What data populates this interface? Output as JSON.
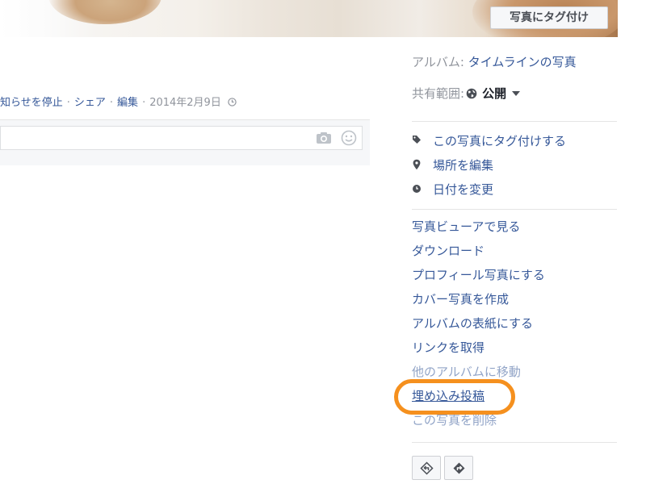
{
  "photo": {
    "tag_button_label": "写真にタグ付け"
  },
  "story": {
    "meta": {
      "unfollow": "知らせを停止",
      "share": "シェア",
      "edit": "編集",
      "date": "2014年2月9日",
      "separator": "·"
    },
    "comment": {
      "placeholder": ""
    }
  },
  "sidebar": {
    "album": {
      "key": "アルバム:",
      "value": "タイムラインの写真"
    },
    "privacy": {
      "key": "共有範囲:",
      "value": "公開"
    },
    "actions": [
      {
        "label": "この写真にタグ付けする",
        "icon": "tag-icon"
      },
      {
        "label": "場所を編集",
        "icon": "location-pin-icon"
      },
      {
        "label": "日付を変更",
        "icon": "clock-icon"
      }
    ],
    "links": [
      {
        "label": "写真ビューアで見る"
      },
      {
        "label": "ダウンロード"
      },
      {
        "label": "プロフィール写真にする"
      },
      {
        "label": "カバー写真を作成"
      },
      {
        "label": "アルバムの表紙にする"
      },
      {
        "label": "リンクを取得"
      },
      {
        "label": "他のアルバムに移動"
      },
      {
        "label": "埋め込み投稿"
      },
      {
        "label": "この写真を削除"
      }
    ],
    "highlighted_link": "埋め込み投稿"
  },
  "colors": {
    "link": "#365899",
    "muted": "#90949c",
    "highlight_ring": "#f5901e"
  }
}
